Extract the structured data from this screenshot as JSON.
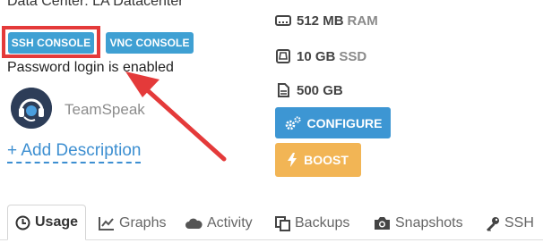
{
  "server": {
    "datacenter_text": "Data Center: LA Datacenter",
    "ssh_console_label": "SSH CONSOLE",
    "vnc_console_label": "VNC CONSOLE",
    "password_status": "Password login is enabled",
    "app_name": "TeamSpeak",
    "add_description_label": "+ Add Description"
  },
  "specs": {
    "ram_value": "512 MB",
    "ram_unit": "RAM",
    "disk_value": "10 GB",
    "disk_unit": "SSD",
    "bandwidth_value": "500 GB"
  },
  "actions": {
    "configure_label": "CONFIGURE",
    "boost_label": "BOOST"
  },
  "tabs": [
    {
      "label": "Usage",
      "icon": "clock-icon",
      "active": true
    },
    {
      "label": "Graphs",
      "icon": "line-chart-icon"
    },
    {
      "label": "Activity",
      "icon": "cloud-icon"
    },
    {
      "label": "Backups",
      "icon": "copy-icon"
    },
    {
      "label": "Snapshots",
      "icon": "camera-icon"
    },
    {
      "label": "SSH",
      "icon": "key-icon"
    }
  ],
  "colors": {
    "primary": "#3fa0d3",
    "boost": "#f2b555",
    "annotation": "#e43a3a",
    "link": "#3d8fd1"
  }
}
